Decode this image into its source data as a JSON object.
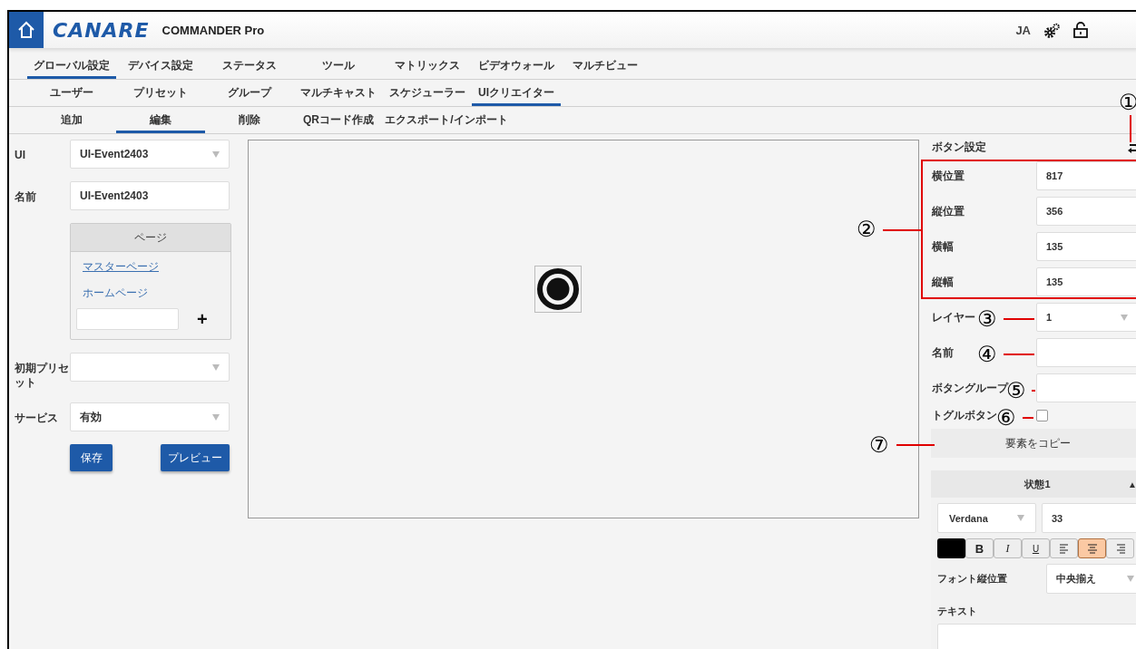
{
  "header": {
    "logo": "CANARE",
    "product": "COMMANDER Pro",
    "language": "JA"
  },
  "nav_tabs": [
    {
      "label": "グローバル設定",
      "selected": true
    },
    {
      "label": "デバイス設定",
      "selected": false
    },
    {
      "label": "ステータス",
      "selected": false
    },
    {
      "label": "ツール",
      "selected": false
    },
    {
      "label": "マトリックス",
      "selected": false
    },
    {
      "label": "ビデオウォール",
      "selected": false
    },
    {
      "label": "マルチビュー",
      "selected": false
    }
  ],
  "sub_tabs": [
    {
      "label": "ユーザー",
      "selected": false
    },
    {
      "label": "プリセット",
      "selected": false
    },
    {
      "label": "グループ",
      "selected": false
    },
    {
      "label": "マルチキャスト",
      "selected": false
    },
    {
      "label": "スケジューラー",
      "selected": false
    },
    {
      "label": "UIクリエイター",
      "selected": true
    }
  ],
  "action_tabs": [
    {
      "label": "追加",
      "selected": false
    },
    {
      "label": "編集",
      "selected": true
    },
    {
      "label": "削除",
      "selected": false
    },
    {
      "label": "QRコード作成",
      "selected": false
    },
    {
      "label": "エクスポート/インポート",
      "selected": false
    }
  ],
  "left_form": {
    "ui_label": "UI",
    "ui_value": "UI-Event2403",
    "name_label": "名前",
    "name_value": "UI-Event2403",
    "pages": {
      "title": "ページ",
      "items": [
        {
          "label": "マスターページ",
          "selected": true
        },
        {
          "label": "ホームページ",
          "selected": false
        }
      ],
      "add": "+"
    },
    "preset_label": "初期プリセット",
    "service_label": "サービス",
    "service_value": "有効",
    "buttons": [
      "保存",
      "プレビュー"
    ]
  },
  "right_panel": {
    "title": "ボタン設定",
    "fields": [
      {
        "kind": "text",
        "label": "横位置",
        "value": "817"
      },
      {
        "kind": "text",
        "label": "縦位置",
        "value": "356"
      },
      {
        "kind": "text",
        "label": "横幅",
        "value": "135"
      },
      {
        "kind": "text",
        "label": "縦幅",
        "value": "135"
      },
      {
        "kind": "select",
        "label": "レイヤー",
        "value": "1"
      },
      {
        "kind": "text",
        "label": "名前"
      },
      {
        "kind": "text",
        "label": "ボタングループ"
      },
      {
        "kind": "checkbox",
        "label": "トグルボタン",
        "checked": false
      }
    ],
    "copy_button": "要素をコピー",
    "state_section": {
      "title": "状態1",
      "toggle": "▲",
      "font": "Verdana",
      "size": "33",
      "format_buttons": [
        {
          "kind": "color",
          "color": "#000000"
        },
        {
          "kind": "bold",
          "label": "B",
          "selected": false
        },
        {
          "kind": "italic",
          "label": "I",
          "selected": false
        },
        {
          "kind": "underline",
          "label": "U",
          "selected": false
        },
        {
          "kind": "align-left",
          "selected": false
        },
        {
          "kind": "align-center",
          "selected": true
        },
        {
          "kind": "align-right",
          "selected": false
        }
      ],
      "vertical_label": "フォント縦位置",
      "vertical_value": "中央揃え",
      "text_label": "テキスト"
    }
  },
  "annotations": [
    {
      "label": "①"
    },
    {
      "label": "②"
    },
    {
      "label": "③"
    },
    {
      "label": "④"
    },
    {
      "label": "⑤"
    },
    {
      "label": "⑥"
    },
    {
      "label": "⑦"
    }
  ]
}
